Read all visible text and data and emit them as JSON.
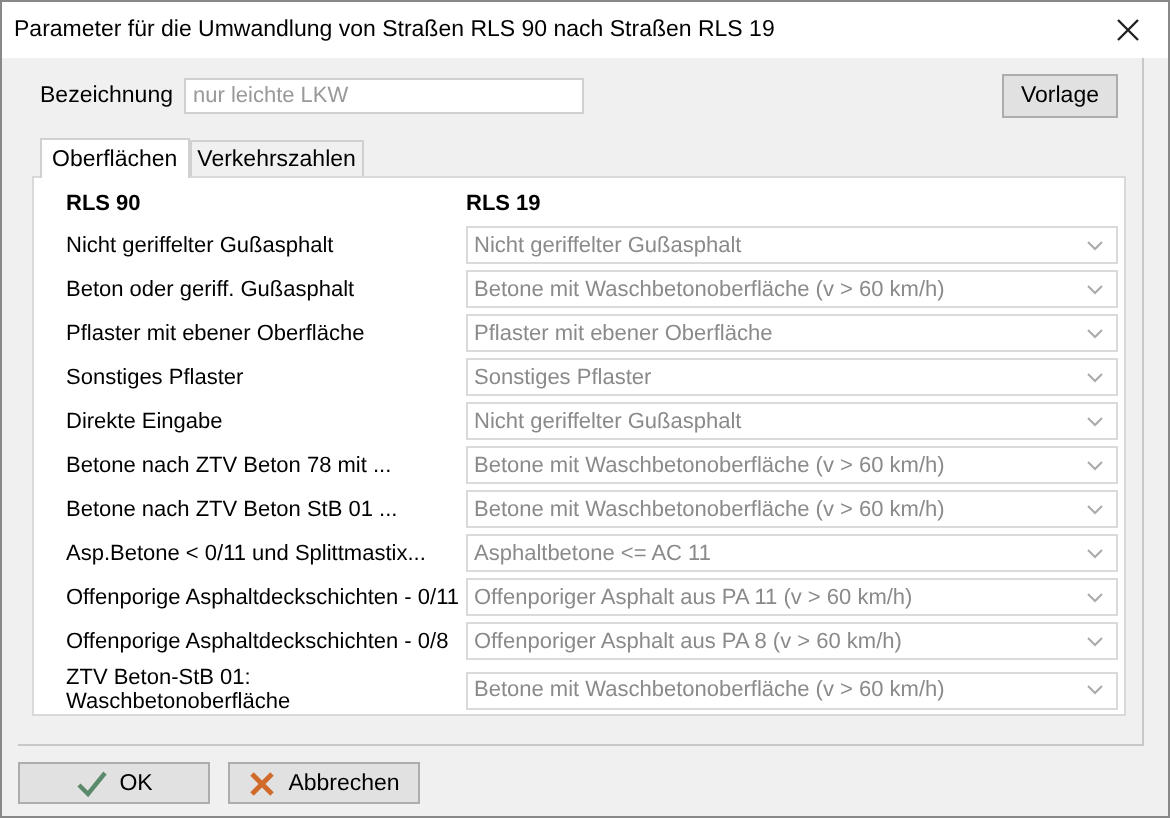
{
  "window": {
    "title": "Parameter für die Umwandlung von Straßen RLS 90 nach Straßen RLS 19"
  },
  "name_field": {
    "label": "Bezeichnung",
    "placeholder": "nur leichte LKW"
  },
  "template_button": "Vorlage",
  "tabs": [
    {
      "label": "Oberflächen",
      "selected": true
    },
    {
      "label": "Verkehrszahlen",
      "selected": false
    }
  ],
  "columns": [
    "RLS 90",
    "RLS 19"
  ],
  "rows": [
    {
      "source": "Nicht geriffelter Gußasphalt",
      "target": "Nicht geriffelter Gußasphalt",
      "disabled": true
    },
    {
      "source": "Beton oder geriff. Gußasphalt",
      "target": "Betone mit Waschbetonoberfläche (v > 60 km/h)",
      "disabled": true
    },
    {
      "source": "Pflaster mit ebener Oberfläche",
      "target": "Pflaster mit ebener Oberfläche",
      "disabled": true
    },
    {
      "source": "Sonstiges Pflaster",
      "target": "Sonstiges Pflaster",
      "disabled": true
    },
    {
      "source": "Direkte Eingabe",
      "target": "Nicht geriffelter Gußasphalt",
      "disabled": true
    },
    {
      "source": "Betone nach ZTV Beton 78 mit ...",
      "target": "Betone mit Waschbetonoberfläche (v > 60 km/h)",
      "disabled": true
    },
    {
      "source": "Betone nach ZTV Beton StB 01 ...",
      "target": "Betone mit Waschbetonoberfläche (v > 60 km/h)",
      "disabled": true
    },
    {
      "source": "Asp.Betone < 0/11 und Splittmastix...",
      "target": "Asphaltbetone <= AC 11",
      "disabled": true
    },
    {
      "source": "Offenporige Asphaltdeckschichten - 0/11",
      "target": "Offenporiger Asphalt aus PA 11 (v > 60 km/h)",
      "disabled": true
    },
    {
      "source": "Offenporige Asphaltdeckschichten - 0/8",
      "target": "Offenporiger Asphalt aus PA 8 (v > 60 km/h)",
      "disabled": true
    },
    {
      "source": "ZTV Beton-StB 01: Waschbetonoberfläche",
      "target": "Betone mit Waschbetonoberfläche (v > 60 km/h)",
      "disabled": true
    }
  ],
  "buttons": [
    {
      "label": "OK",
      "kind": "ok"
    },
    {
      "label": "Abbrechen",
      "kind": "cancel"
    }
  ]
}
